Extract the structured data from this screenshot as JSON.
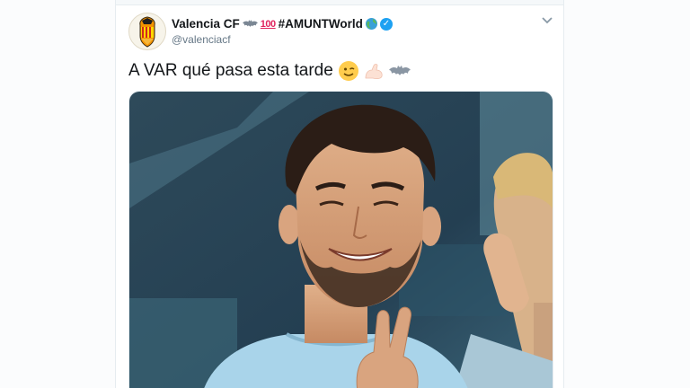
{
  "tweet": {
    "display_name": "Valencia CF",
    "hashtag": "#AMUNTWorld",
    "emoji_100": "100",
    "handle": "@valenciacf",
    "text": "A VAR qué pasa esta tarde"
  },
  "icons": {
    "avatar": "valencia-crest",
    "bat": "bat-icon",
    "globe": "globe-icon",
    "verified": "verified-badge-icon",
    "caret": "chevron-down-icon",
    "wink": "winking-face-emoji",
    "muscle": "flexed-biceps-emoji"
  },
  "colors": {
    "verified": "#1da1f2",
    "handle": "#657786",
    "text": "#14171a",
    "club_orange": "#f39200"
  },
  "media": {
    "description_icon": "photo-of-smiling-player"
  }
}
